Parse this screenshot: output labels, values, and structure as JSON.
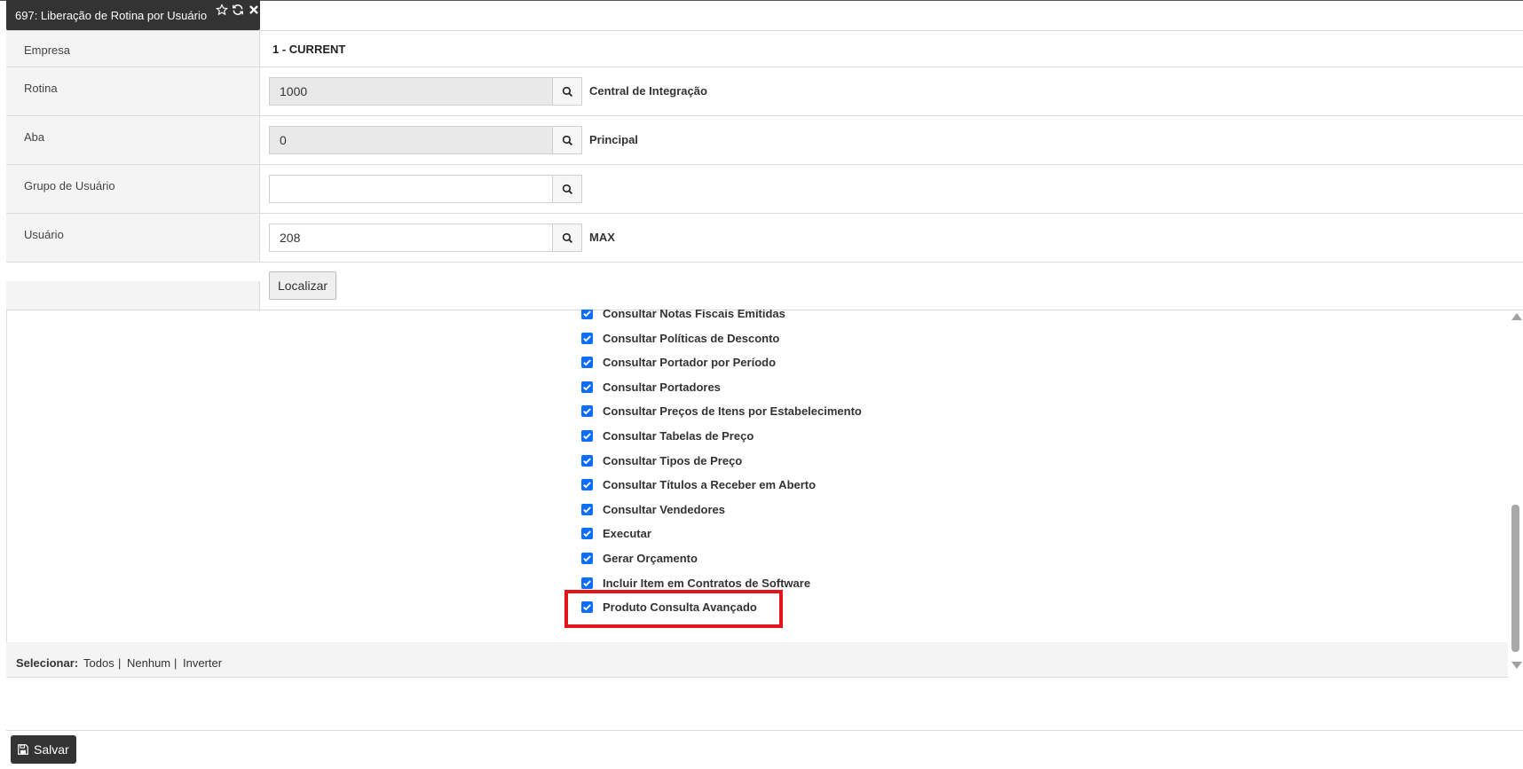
{
  "tab": {
    "title": "697: Liberação de Rotina por Usuário"
  },
  "form": {
    "empresa": {
      "label": "Empresa",
      "value": "1 - CURRENT"
    },
    "rotina": {
      "label": "Rotina",
      "value": "1000",
      "description": "Central de Integração"
    },
    "aba": {
      "label": "Aba",
      "value": "0",
      "description": "Principal"
    },
    "grupo": {
      "label": "Grupo de Usuário",
      "value": ""
    },
    "usuario": {
      "label": "Usuário",
      "value": "208",
      "description": "MAX"
    },
    "localizar_label": "Localizar"
  },
  "permissions": [
    {
      "label": "Consultar Notas Fiscais Emitidas",
      "checked": true
    },
    {
      "label": "Consultar Políticas de Desconto",
      "checked": true
    },
    {
      "label": "Consultar Portador por Período",
      "checked": true
    },
    {
      "label": "Consultar Portadores",
      "checked": true
    },
    {
      "label": "Consultar Preços de Itens por Estabelecimento",
      "checked": true
    },
    {
      "label": "Consultar Tabelas de Preço",
      "checked": true
    },
    {
      "label": "Consultar Tipos de Preço",
      "checked": true
    },
    {
      "label": "Consultar Títulos a Receber em Aberto",
      "checked": true
    },
    {
      "label": "Consultar Vendedores",
      "checked": true
    },
    {
      "label": "Executar",
      "checked": true
    },
    {
      "label": "Gerar Orçamento",
      "checked": true
    },
    {
      "label": "Incluir Item em Contratos de Software",
      "checked": true
    },
    {
      "label": "Produto Consulta Avançado",
      "checked": true
    }
  ],
  "selection": {
    "label": "Selecionar:",
    "todos": "Todos",
    "nenhum": "Nenhum",
    "inverter": "Inverter",
    "sep1": "|",
    "sep2": "|"
  },
  "footer": {
    "save_label": "Salvar"
  },
  "colors": {
    "highlight": "#e0161b",
    "checkbox": "#0d6efd",
    "dark": "#333333"
  }
}
